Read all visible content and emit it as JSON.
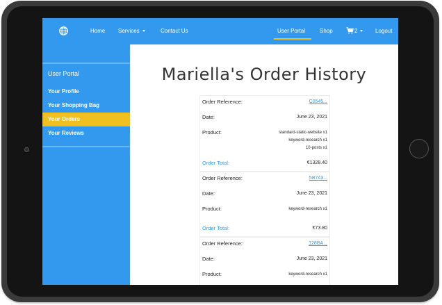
{
  "navbar": {
    "logo_icon": "globe-icon",
    "home_label": "Home",
    "services_label": "Services",
    "contact_label": "Contact Us",
    "user_portal_label": "User Portal",
    "shop_label": "Shop",
    "cart_count": "2",
    "logout_label": "Logout",
    "accent_color": "#f0c020",
    "bar_color": "#3399ee"
  },
  "sidebar": {
    "heading": "User Portal",
    "items": [
      {
        "label": "Your Profile"
      },
      {
        "label": "Your Shopping Bag"
      },
      {
        "label": "Your Orders",
        "active": true
      },
      {
        "label": "Your Reviews"
      }
    ]
  },
  "main": {
    "title": "Mariella's Order History",
    "labels": {
      "order_reference": "Order Reference:",
      "date": "Date:",
      "product": "Product:",
      "order_total": "Order Total:"
    },
    "orders": [
      {
        "reference": "C0545...",
        "date": "June 23, 2021",
        "products": [
          "standard-static-website x1",
          "keyword-research x1",
          "10-posts x1"
        ],
        "total": "€1328.40"
      },
      {
        "reference": "5B743...",
        "date": "June 23, 2021",
        "products": [
          "keyword-research x1"
        ],
        "total": "€73.80"
      },
      {
        "reference": "128BA...",
        "date": "June 23, 2021",
        "products": [
          "keyword-research x1"
        ],
        "total": ""
      }
    ]
  }
}
